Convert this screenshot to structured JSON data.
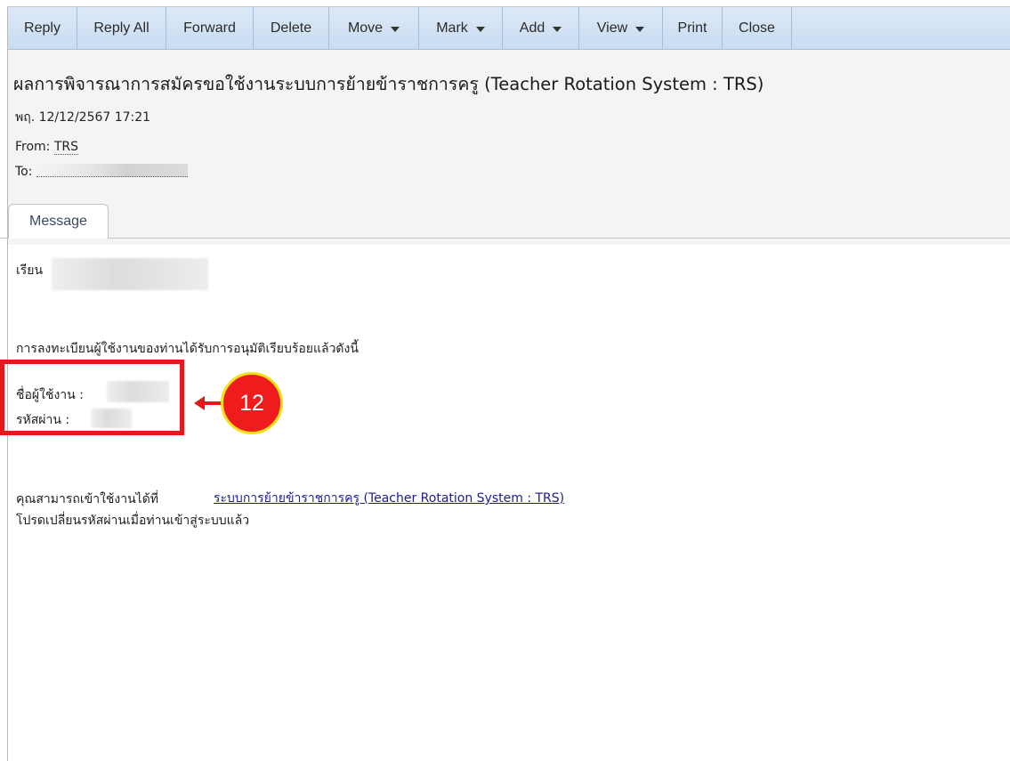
{
  "toolbar": {
    "buttons": [
      {
        "label": "Reply",
        "dropdown": false
      },
      {
        "label": "Reply All",
        "dropdown": false
      },
      {
        "label": "Forward",
        "dropdown": false
      },
      {
        "label": "Delete",
        "dropdown": false
      },
      {
        "label": "Move",
        "dropdown": true
      },
      {
        "label": "Mark",
        "dropdown": true
      },
      {
        "label": "Add",
        "dropdown": true
      },
      {
        "label": "View",
        "dropdown": true
      },
      {
        "label": "Print",
        "dropdown": false
      },
      {
        "label": "Close",
        "dropdown": false
      }
    ]
  },
  "email": {
    "subject": "ผลการพิจารณาการสมัครขอใช้งานระบบการย้ายข้าราชการครู (Teacher Rotation System : TRS)",
    "date": "พฤ. 12/12/2567 17:21",
    "from_label": "From:",
    "from_name": "TRS",
    "to_label": "To:"
  },
  "tabs": {
    "message": "Message"
  },
  "body": {
    "greeting": "เรียน",
    "intro": "การลงทะเบียนผู้ใช้งานของท่านได้รับการอนุมัติเรียบร้อยแล้วดังนี้",
    "username_label": "ชื่อผู้ใช้งาน :",
    "password_label": "รหัสผ่าน :",
    "access_text": "คุณสามารถเข้าใช้งานได้ที่",
    "link_text": "ระบบการย้ายข้าราชการครู (Teacher Rotation System : TRS)",
    "change_password_note": "โปรดเปลี่ยนรหัสผ่านเมื่อท่านเข้าสู่ระบบแล้ว"
  },
  "annotation": {
    "step_number": "12"
  },
  "colors": {
    "toolbar_bg": "#d3e3f5",
    "header_bg": "#f4f4f4",
    "highlight_red": "#e3191d",
    "badge_border": "#f1e217",
    "link": "#1c1c8c"
  }
}
